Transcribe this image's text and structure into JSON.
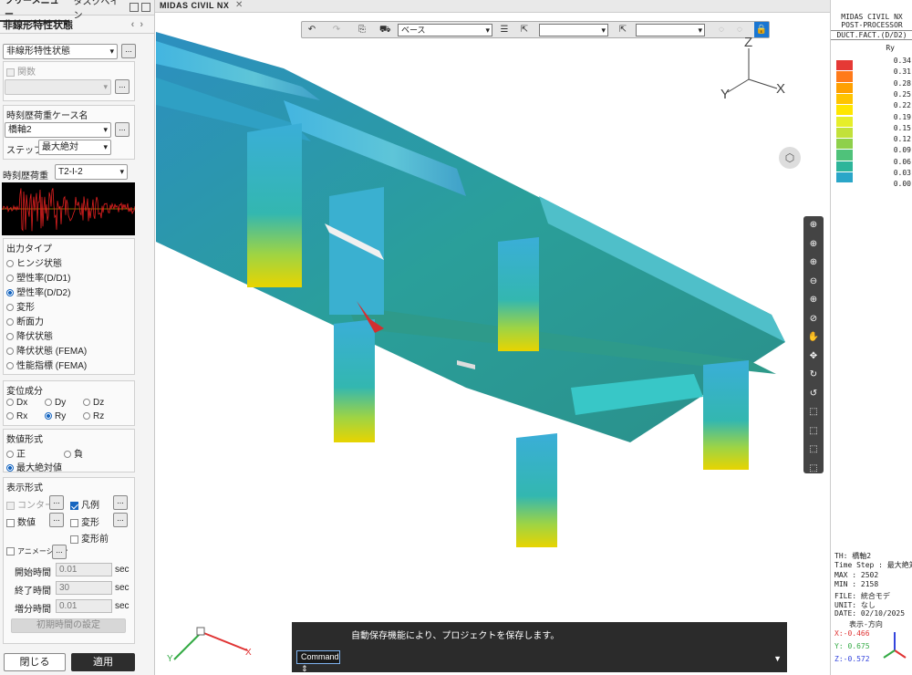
{
  "left_panel": {
    "tab_tree": "ツリーメニュー",
    "tab_task": "タスクペイン",
    "section_title": "非線形特性状態",
    "mode_select": "非線形特性状態",
    "func_label": "関数",
    "th_case_label": "時刻歴荷重ケース名",
    "th_case_value": "橋軸2",
    "step_label": "ステップ",
    "step_value": "最大絶対",
    "th_load_label": "時刻歴荷重",
    "th_load_value": "T2-I-2",
    "output_type_label": "出力タイプ",
    "output_types": [
      "ヒンジ状態",
      "塑性率(D/D1)",
      "塑性率(D/D2)",
      "変形",
      "断面力",
      "降伏状態",
      "降伏状態 (FEMA)",
      "性能指標 (FEMA)"
    ],
    "output_selected": 2,
    "component_label": "変位成分",
    "components": [
      "Dx",
      "Dy",
      "Dz",
      "Rx",
      "Ry",
      "Rz"
    ],
    "component_selected": 4,
    "sign_label": "数値形式",
    "signs": [
      "正",
      "負",
      "最大絶対値"
    ],
    "sign_selected": 2,
    "display_label": "表示形式",
    "contour_label": "コンター図",
    "legend_label": "凡例",
    "value_label": "数値",
    "deform_label": "変形",
    "predeform_label": "変形前",
    "anim_label": "アニメーション",
    "start_time_label": "開始時間",
    "start_time_value": "0.01",
    "end_time_label": "終了時間",
    "end_time_value": "30",
    "incr_time_label": "増分時間",
    "incr_time_value": "0.01",
    "unit_sec": "sec",
    "init_time_button": "初期時間の設定",
    "close_button": "閉じる",
    "apply_button": "適用"
  },
  "doc_tab": {
    "title": "MIDAS CIVIL NX",
    "close": "✕"
  },
  "toolbar": {
    "base_select": "ベース"
  },
  "command": {
    "message": "自動保存機能により、プロジェクトを保存します。",
    "label": "Command"
  },
  "axes": {
    "z": "Z",
    "y": "Y",
    "x": "X"
  },
  "legend": {
    "title1": "MIDAS CIVIL NX",
    "title2": "POST-PROCESSOR",
    "title3": "DUCT.FACT.(D/D2)",
    "comp": "Ry",
    "values": [
      "0.34",
      "0.31",
      "0.28",
      "0.25",
      "0.22",
      "0.19",
      "0.15",
      "0.12",
      "0.09",
      "0.06",
      "0.03",
      "0.00"
    ],
    "colors": [
      "#e53935",
      "#ff7a1a",
      "#ffa000",
      "#ffc400",
      "#ffe600",
      "#e6ee2a",
      "#c2e13a",
      "#8ed04b",
      "#4fc27a",
      "#2db59a",
      "#2aa6c8",
      "#36a0e0"
    ],
    "th": "TH: 橋軸2",
    "time_step": "Time Step : 最大絶対",
    "max": "MAX : 2502",
    "min": "MIN : 2158",
    "file": "FILE: 統合モデ",
    "unit": "UNIT: なし",
    "date": "DATE: 02/10/2025",
    "dir_label": "表示-方向",
    "x_dir": "X:-0.466",
    "y_dir": "Y: 0.675",
    "z_dir": "Z:-0.572"
  }
}
